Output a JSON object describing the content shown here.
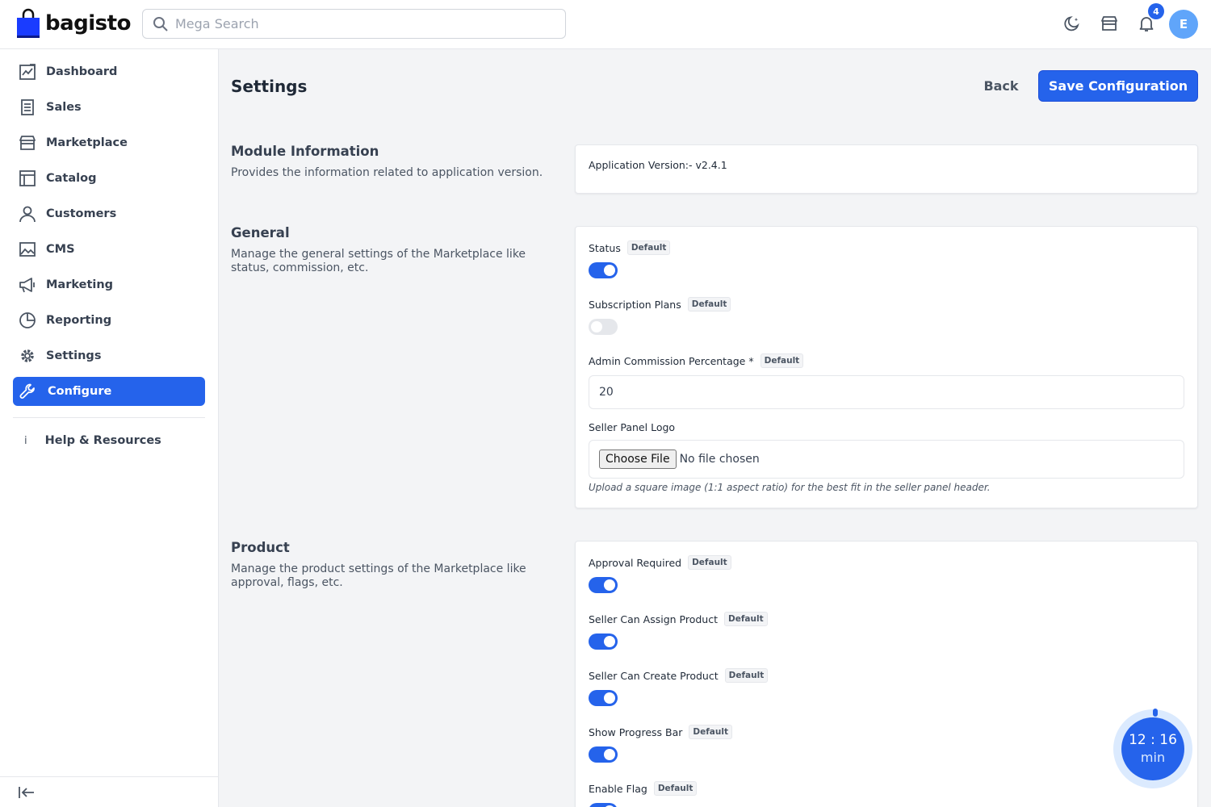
{
  "brand": {
    "name": "bagisto"
  },
  "search": {
    "placeholder": "Mega Search"
  },
  "header": {
    "notification_count": "4",
    "avatar_initial": "E"
  },
  "sidebar": {
    "items": [
      {
        "label": "Dashboard",
        "icon": "dashboard-icon"
      },
      {
        "label": "Sales",
        "icon": "sales-icon"
      },
      {
        "label": "Marketplace",
        "icon": "store-icon"
      },
      {
        "label": "Catalog",
        "icon": "catalog-icon"
      },
      {
        "label": "Customers",
        "icon": "customer-icon"
      },
      {
        "label": "CMS",
        "icon": "image-icon"
      },
      {
        "label": "Marketing",
        "icon": "megaphone-icon"
      },
      {
        "label": "Reporting",
        "icon": "pie-chart-icon"
      },
      {
        "label": "Settings",
        "icon": "gear-icon"
      },
      {
        "label": "Configure",
        "icon": "wrench-icon",
        "active": true
      }
    ],
    "help": {
      "label": "Help & Resources",
      "icon": "info-icon"
    }
  },
  "page": {
    "title": "Settings",
    "back_label": "Back",
    "save_label": "Save Configuration"
  },
  "sections": {
    "module": {
      "title": "Module Information",
      "description": "Provides the information related to application version.",
      "version_text": "Application Version:- v2.4.1"
    },
    "general": {
      "title": "General",
      "description": "Manage the general settings of the Marketplace like status, commission, etc.",
      "status_label": "Status",
      "status_on": true,
      "subscription_label": "Subscription Plans",
      "subscription_on": false,
      "commission_label": "Admin Commission Percentage *",
      "commission_value": "20",
      "logo_label": "Seller Panel Logo",
      "file_button": "Choose File",
      "file_status": "No file chosen",
      "logo_hint": "Upload a square image (1:1 aspect ratio) for the best fit in the seller panel header."
    },
    "product": {
      "title": "Product",
      "description": "Manage the product settings of the Marketplace like approval, flags, etc.",
      "approval_label": "Approval Required",
      "assign_label": "Seller Can Assign Product",
      "create_label": "Seller Can Create Product",
      "progress_label": "Show Progress Bar",
      "flag_label": "Enable Flag"
    },
    "default_tag": "Default"
  },
  "timer": {
    "time": "12 : 16",
    "unit": "min"
  },
  "colors": {
    "primary": "#2563eb",
    "avatar": "#60a5fa"
  }
}
